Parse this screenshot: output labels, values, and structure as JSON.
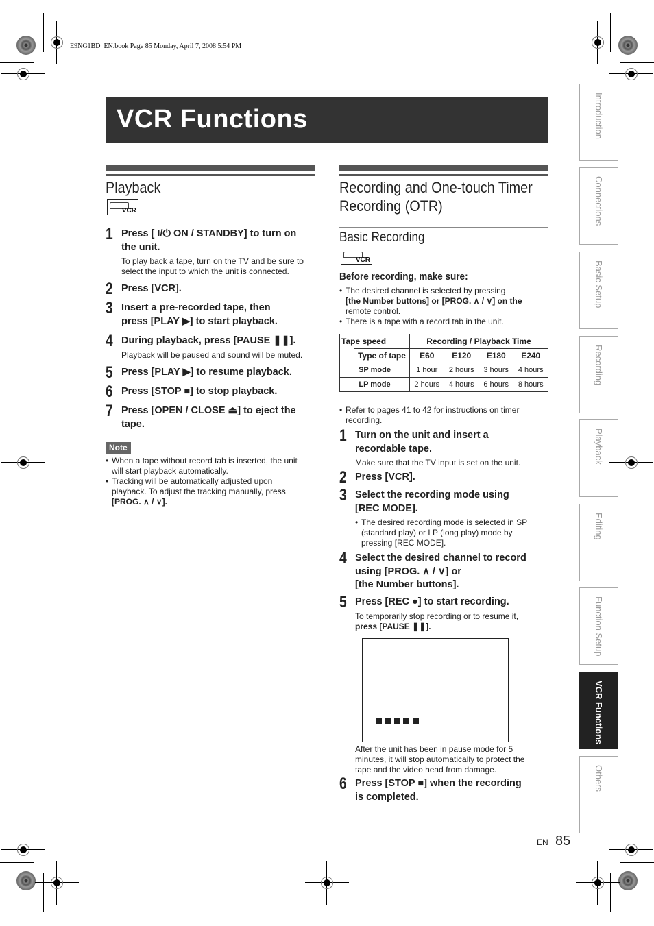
{
  "print_header": "E9NG1BD_EN.book  Page 85  Monday, April 7, 2008  5:54 PM",
  "page_title": "VCR Functions",
  "playback": {
    "title": "Playback",
    "icon_label": "VCR",
    "steps": [
      {
        "num": "1",
        "lines": [
          "Press [ I/⏻ ON / STANDBY] to turn on",
          "the unit."
        ],
        "desc": [
          "To play back a tape, turn on the TV and be sure to",
          "select the input to which the unit is connected."
        ]
      },
      {
        "num": "2",
        "lines": [
          "Press [VCR]."
        ]
      },
      {
        "num": "3",
        "lines": [
          "Insert a pre-recorded tape, then",
          "press [PLAY ▶] to start playback."
        ]
      },
      {
        "num": "4",
        "lines": [
          "During playback, press [PAUSE ❚❚]."
        ],
        "desc": [
          "Playback will be paused and sound will be muted."
        ]
      },
      {
        "num": "5",
        "lines": [
          "Press [PLAY ▶] to resume playback."
        ]
      },
      {
        "num": "6",
        "lines": [
          "Press [STOP ■] to stop playback."
        ]
      },
      {
        "num": "7",
        "lines": [
          "Press [OPEN / CLOSE ⏏] to eject the",
          "tape."
        ]
      }
    ],
    "note_label": "Note",
    "notes": [
      [
        "When a tape without record tab is inserted, the unit",
        "will start playback automatically."
      ],
      [
        "Tracking will be automatically adjusted upon",
        "playback. To adjust the tracking manually, press",
        "[PROG. ∧ / ∨]."
      ]
    ]
  },
  "recording": {
    "title_lines": [
      "Recording and One-touch Timer",
      "Recording (OTR)"
    ],
    "subtitle": "Basic Recording",
    "icon_label": "VCR",
    "before_heading": "Before recording, make sure:",
    "before_bullets": [
      [
        "The desired channel is selected by pressing",
        "[the Number buttons] or [PROG. ∧ / ∨] on the",
        "remote control."
      ],
      [
        "There is a tape with a record tab in the unit."
      ]
    ],
    "table": {
      "header_left": "Tape speed",
      "header_right": "Recording / Playback Time",
      "type_label": "Type of tape",
      "tape_types": [
        "E60",
        "E120",
        "E180",
        "E240"
      ],
      "rows": [
        {
          "mode": "SP mode",
          "values": [
            "1 hour",
            "2 hours",
            "3 hours",
            "4 hours"
          ]
        },
        {
          "mode": "LP mode",
          "values": [
            "2 hours",
            "4 hours",
            "6 hours",
            "8 hours"
          ]
        }
      ]
    },
    "refer_note": [
      "Refer to pages 41 to 42 for instructions on timer",
      "recording."
    ],
    "steps": [
      {
        "num": "1",
        "lines": [
          "Turn on the unit and insert a",
          "recordable tape."
        ],
        "desc": [
          "Make sure that the TV input is set on the unit."
        ]
      },
      {
        "num": "2",
        "lines": [
          "Press [VCR]."
        ]
      },
      {
        "num": "3",
        "lines": [
          "Select the recording mode using",
          "[REC MODE]."
        ],
        "bullet": [
          "The desired recording mode is selected in SP",
          "(standard play) or LP (long play) mode by",
          "pressing [REC MODE]."
        ]
      },
      {
        "num": "4",
        "lines": [
          "Select the desired channel to record",
          "using [PROG. ∧ / ∨] or",
          "[the Number buttons]."
        ]
      },
      {
        "num": "5",
        "lines": [
          "Press [REC ●] to start recording."
        ],
        "desc": [
          "To temporarily stop recording or to resume it,",
          "press [PAUSE ❚❚]."
        ]
      },
      {
        "num": "6",
        "lines": [
          "Press [STOP ■] when the recording",
          "is completed."
        ]
      }
    ],
    "screen_caption": [
      "After the unit has been in pause mode for 5",
      "minutes, it will stop automatically to protect the",
      "tape and the video head from damage."
    ]
  },
  "side_tabs": [
    "Introduction",
    "Connections",
    "Basic Setup",
    "Recording",
    "Playback",
    "Editing",
    "Function Setup",
    "VCR Functions",
    "Others"
  ],
  "active_tab": "VCR Functions",
  "footer": {
    "lang": "EN",
    "page": "85"
  }
}
